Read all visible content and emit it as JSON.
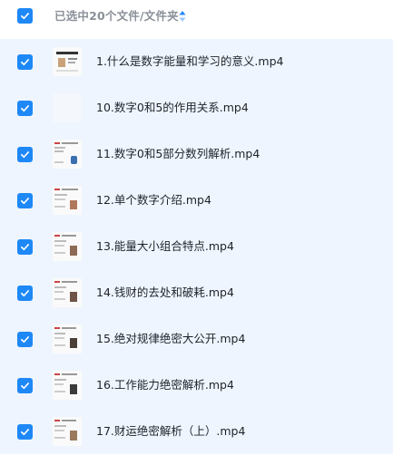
{
  "header": {
    "select_all_checked": true,
    "selection_text": "已选中20个文件/文件夹",
    "sort_icon": "sort-updown-icon"
  },
  "colors": {
    "accent": "#1e88f7",
    "list_bg": "#eef5fe",
    "header_text": "#8a9099",
    "file_text": "#1f2329"
  },
  "files": [
    {
      "name": "1.什么是数字能量和学习的意义.mp4",
      "checked": true
    },
    {
      "name": "10.数字0和5的作用关系.mp4",
      "checked": true
    },
    {
      "name": "11.数字0和5部分数列解析.mp4",
      "checked": true
    },
    {
      "name": "12.单个数字介绍.mp4",
      "checked": true
    },
    {
      "name": "13.能量大小组合特点.mp4",
      "checked": true
    },
    {
      "name": "14.钱财的去处和破耗.mp4",
      "checked": true
    },
    {
      "name": "15.绝对规律绝密大公开.mp4",
      "checked": true
    },
    {
      "name": "16.工作能力绝密解析.mp4",
      "checked": true
    },
    {
      "name": "17.财运绝密解析（上）.mp4",
      "checked": true
    }
  ]
}
